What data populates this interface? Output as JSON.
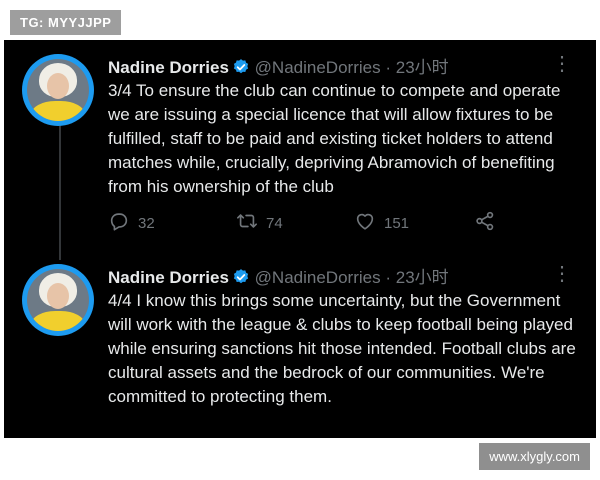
{
  "badge": {
    "text": "TG: MYYJJPP"
  },
  "watermark": {
    "text": "www.xlygly.com"
  },
  "tweets": [
    {
      "name": "Nadine Dorries",
      "handle": "@NadineDorries",
      "separator": "·",
      "time": "23小时",
      "text": "3/4 To ensure the club can continue to compete and operate we are issuing a special licence that will allow fixtures to be fulfilled, staff to be paid and existing ticket holders to attend matches while, crucially, depriving Abramovich of benefiting from his ownership of the club",
      "replies": "32",
      "retweets": "74",
      "likes": "151"
    },
    {
      "name": "Nadine Dorries",
      "handle": "@NadineDorries",
      "separator": "·",
      "time": "23小时",
      "text": "4/4 I know this brings some uncertainty, but the Government will work with the league & clubs to keep football being played while ensuring sanctions hit those intended. Football clubs are cultural assets and the bedrock of our communities. We're committed to protecting them."
    }
  ],
  "icons": {
    "verified": "verified-badge-icon",
    "more": "more-options-icon",
    "reply": "reply-icon",
    "retweet": "retweet-icon",
    "like": "heart-icon",
    "share": "share-icon"
  },
  "colors": {
    "background": "#000000",
    "text": "#e7e9ea",
    "muted": "#71767b",
    "verified": "#1d9bf0",
    "avatar_ring": "#1d9bf0"
  }
}
